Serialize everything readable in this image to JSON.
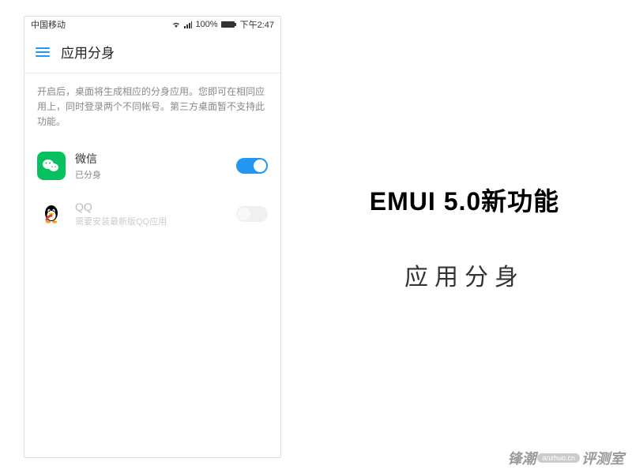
{
  "status_bar": {
    "carrier": "中国移动",
    "signal_text": "100%",
    "time": "下午2:47"
  },
  "header": {
    "title": "应用分身"
  },
  "description": "开启后，桌面将生成相应的分身应用。您即可在相同应用上，同时登录两个不同帐号。第三方桌面暂不支持此功能。",
  "apps": [
    {
      "name": "微信",
      "status": "已分身",
      "toggle_on": true,
      "enabled": true,
      "icon": "wechat"
    },
    {
      "name": "QQ",
      "status": "需要安装最新版QQ应用",
      "toggle_on": false,
      "enabled": false,
      "icon": "qq"
    }
  ],
  "feature": {
    "title": "EMUI 5.0新功能",
    "subtitle": "应用分身"
  },
  "watermark": {
    "text": "锋潮",
    "suffix": "评测室",
    "badge": "anzhuo.cn"
  }
}
